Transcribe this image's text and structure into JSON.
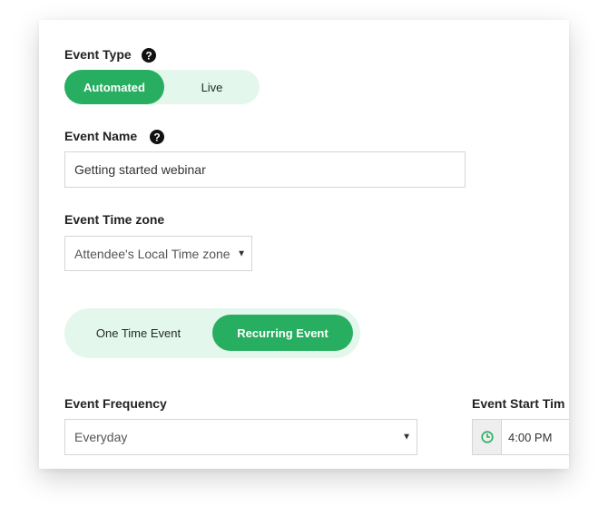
{
  "event_type": {
    "label": "Event Type",
    "options": [
      "Automated",
      "Live"
    ],
    "selected": "Automated"
  },
  "event_name": {
    "label": "Event Name",
    "value": "Getting started webinar"
  },
  "event_timezone": {
    "label": "Event Time zone",
    "selected": "Attendee's Local Time zone"
  },
  "event_schedule": {
    "options": [
      "One Time Event",
      "Recurring Event"
    ],
    "selected": "Recurring Event"
  },
  "event_frequency": {
    "label": "Event Frequency",
    "selected": "Everyday"
  },
  "event_start_time": {
    "label": "Event Start Tim",
    "value": "4:00 PM"
  },
  "icons": {
    "help": "question-circle-icon",
    "clock": "clock-icon",
    "caret": "caret-down-icon"
  },
  "colors": {
    "accent": "#27ae60",
    "accent_light": "#e4f7ec",
    "text": "#222222",
    "border": "#d5d5d5"
  }
}
